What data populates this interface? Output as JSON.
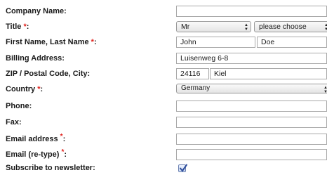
{
  "form": {
    "company": {
      "label": "Company Name:",
      "value": ""
    },
    "title": {
      "label": "Title",
      "required_mark": "*",
      "colon": ":",
      "salutation": "Mr",
      "academic": "please choose"
    },
    "name": {
      "label": "First Name, Last Name",
      "required_mark": "*",
      "colon": ":",
      "first": "John",
      "last": "Doe"
    },
    "billing": {
      "label": "Billing Address:",
      "value": "Luisenweg 6-8"
    },
    "zip_city": {
      "label": "ZIP / Postal Code, City:",
      "zip": "24116",
      "city": "Kiel"
    },
    "country": {
      "label": "Country",
      "required_mark": "*",
      "colon": ":",
      "value": "Germany"
    },
    "phone": {
      "label": "Phone:",
      "value": ""
    },
    "fax": {
      "label": "Fax:",
      "value": ""
    },
    "email": {
      "label": "Email address",
      "required_mark": "*",
      "colon": ":",
      "value": ""
    },
    "email_retype": {
      "label": "Email (re-type)",
      "required_mark": "*",
      "colon": ":",
      "value": ""
    },
    "newsletter": {
      "label": "Subscribe to newsletter:",
      "checked": true
    }
  },
  "colors": {
    "required": "#e0201b",
    "checkbox": "#3b5fb0"
  },
  "icons": {
    "select_arrows": "up-down-arrows-icon",
    "checkmark": "checkmark-icon"
  }
}
